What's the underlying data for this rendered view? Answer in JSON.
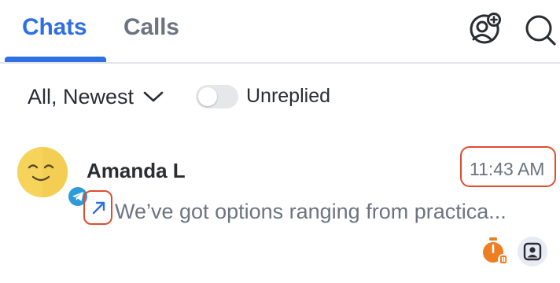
{
  "tabs": [
    {
      "label": "Chats",
      "active": true
    },
    {
      "label": "Calls",
      "active": false
    }
  ],
  "header": {
    "add_contact_icon": "add-contact-icon",
    "search_icon": "search-icon"
  },
  "filter": {
    "selected": "All, Newest",
    "toggle_label": "Unreplied",
    "toggle_on": false
  },
  "chats": [
    {
      "name": "Amanda L",
      "time": "11:43 AM",
      "preview": "We’ve got options ranging from practica...",
      "channel": "telegram",
      "direction": "outgoing"
    }
  ],
  "colors": {
    "accent": "#2f6fe4",
    "highlight_border": "#e04c2f",
    "timer": "#ef7d22",
    "telegram": "#2d9bd9"
  }
}
